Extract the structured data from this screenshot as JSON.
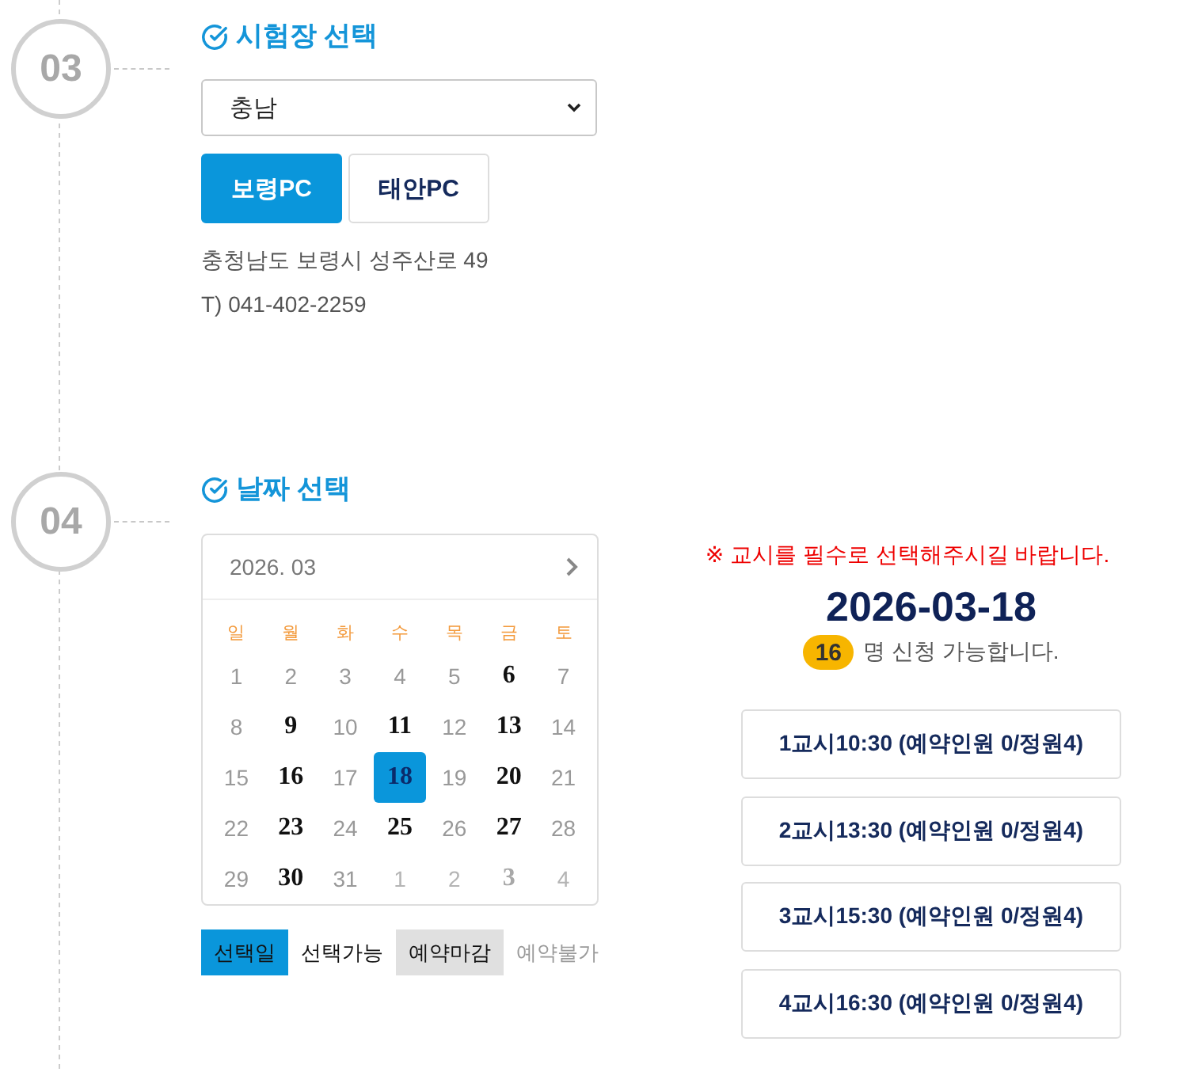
{
  "venue_step": {
    "number": "03",
    "title": "시험장 선택",
    "region_select": {
      "value": "충남"
    },
    "branches": [
      {
        "label": "보령PC",
        "selected": true
      },
      {
        "label": "태안PC",
        "selected": false
      }
    ],
    "address": "충청남도 보령시 성주산로 49",
    "phone": "T) 041-402-2259"
  },
  "date_step": {
    "number": "04",
    "title": "날짜 선택",
    "calendar": {
      "month": "2026. 03",
      "weekdays": [
        "일",
        "월",
        "화",
        "수",
        "목",
        "금",
        "토"
      ],
      "days": [
        {
          "day": "1",
          "available": false,
          "selected": false,
          "outside": false
        },
        {
          "day": "2",
          "available": false,
          "selected": false,
          "outside": false
        },
        {
          "day": "3",
          "available": false,
          "selected": false,
          "outside": false
        },
        {
          "day": "4",
          "available": false,
          "selected": false,
          "outside": false
        },
        {
          "day": "5",
          "available": false,
          "selected": false,
          "outside": false
        },
        {
          "day": "6",
          "available": true,
          "selected": false,
          "outside": false
        },
        {
          "day": "7",
          "available": false,
          "selected": false,
          "outside": false
        },
        {
          "day": "8",
          "available": false,
          "selected": false,
          "outside": false
        },
        {
          "day": "9",
          "available": true,
          "selected": false,
          "outside": false
        },
        {
          "day": "10",
          "available": false,
          "selected": false,
          "outside": false
        },
        {
          "day": "11",
          "available": true,
          "selected": false,
          "outside": false
        },
        {
          "day": "12",
          "available": false,
          "selected": false,
          "outside": false
        },
        {
          "day": "13",
          "available": true,
          "selected": false,
          "outside": false
        },
        {
          "day": "14",
          "available": false,
          "selected": false,
          "outside": false
        },
        {
          "day": "15",
          "available": false,
          "selected": false,
          "outside": false
        },
        {
          "day": "16",
          "available": true,
          "selected": false,
          "outside": false
        },
        {
          "day": "17",
          "available": false,
          "selected": false,
          "outside": false
        },
        {
          "day": "18",
          "available": true,
          "selected": true,
          "outside": false
        },
        {
          "day": "19",
          "available": false,
          "selected": false,
          "outside": false
        },
        {
          "day": "20",
          "available": true,
          "selected": false,
          "outside": false
        },
        {
          "day": "21",
          "available": false,
          "selected": false,
          "outside": false
        },
        {
          "day": "22",
          "available": false,
          "selected": false,
          "outside": false
        },
        {
          "day": "23",
          "available": true,
          "selected": false,
          "outside": false
        },
        {
          "day": "24",
          "available": false,
          "selected": false,
          "outside": false
        },
        {
          "day": "25",
          "available": true,
          "selected": false,
          "outside": false
        },
        {
          "day": "26",
          "available": false,
          "selected": false,
          "outside": false
        },
        {
          "day": "27",
          "available": true,
          "selected": false,
          "outside": false
        },
        {
          "day": "28",
          "available": false,
          "selected": false,
          "outside": false
        },
        {
          "day": "29",
          "available": false,
          "selected": false,
          "outside": false
        },
        {
          "day": "30",
          "available": true,
          "selected": false,
          "outside": false
        },
        {
          "day": "31",
          "available": false,
          "selected": false,
          "outside": false
        },
        {
          "day": "1",
          "available": false,
          "selected": false,
          "outside": true
        },
        {
          "day": "2",
          "available": false,
          "selected": false,
          "outside": true
        },
        {
          "day": "3",
          "available": true,
          "selected": false,
          "outside": true
        },
        {
          "day": "4",
          "available": false,
          "selected": false,
          "outside": true
        }
      ]
    },
    "legend": [
      {
        "label": "선택일",
        "kind": "selected"
      },
      {
        "label": "선택가능",
        "kind": "available"
      },
      {
        "label": "예약마감",
        "kind": "closed"
      },
      {
        "label": "예약불가",
        "kind": "unavailable"
      }
    ],
    "notice": "※ 교시를 필수로 선택해주시길 바랍니다.",
    "selected_date": "2026-03-18",
    "available_count": "16",
    "available_text": "명 신청 가능합니다.",
    "time_slots": [
      {
        "label": "1교시10:30 (예약인원 0/정원4)",
        "selected": false
      },
      {
        "label": "2교시13:30 (예약인원 0/정원4)",
        "selected": false
      },
      {
        "label": "3교시15:30 (예약인원 0/정원4)",
        "selected": false
      },
      {
        "label": "4교시16:30 (예약인원 0/정원4)",
        "selected": false
      }
    ]
  }
}
